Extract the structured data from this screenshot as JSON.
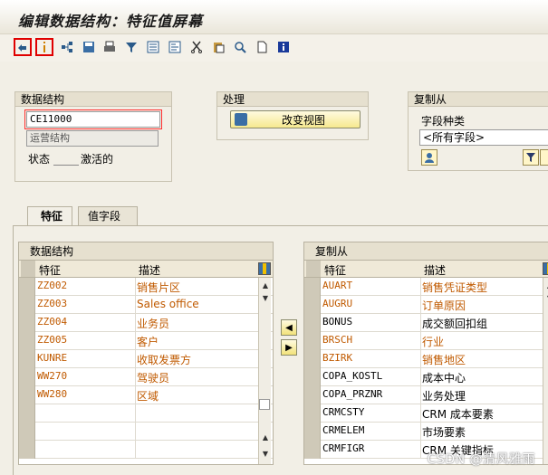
{
  "title": "编辑数据结构：特征值屏幕",
  "toolbar": {
    "icons": [
      "back-arrow-icon",
      "info-marker-icon",
      "hierarchy-icon",
      "save-icon",
      "print-icon",
      "filter-icon",
      "list-icon",
      "detail-icon",
      "cut-icon",
      "paste-icon",
      "find-icon",
      "new-page-icon",
      "info-icon"
    ]
  },
  "data_structure": {
    "group_title": "数据结构",
    "code": "CE11000",
    "description": "运营结构",
    "status_label": "状态",
    "status_value": "激活的"
  },
  "processing": {
    "group_title": "处理",
    "change_view_label": "改变视图"
  },
  "copy_from": {
    "group_title": "复制从",
    "field_type_label": "字段种类",
    "field_type_value": "<所有字段>"
  },
  "tabs": [
    {
      "label": "特征",
      "active": true
    },
    {
      "label": "值字段",
      "active": false
    }
  ],
  "left_table": {
    "title": "数据结构",
    "col1": "特征",
    "col2": "描述",
    "rows": [
      {
        "c1": "ZZ002",
        "c2": "销售片区"
      },
      {
        "c1": "ZZ003",
        "c2": "Sales office"
      },
      {
        "c1": "ZZ004",
        "c2": "业务员"
      },
      {
        "c1": "ZZ005",
        "c2": "客户"
      },
      {
        "c1": "KUNRE",
        "c2": "收取发票方"
      },
      {
        "c1": "WW270",
        "c2": "驾驶员"
      },
      {
        "c1": "WW280",
        "c2": "区域"
      },
      {
        "c1": "",
        "c2": ""
      },
      {
        "c1": "",
        "c2": ""
      },
      {
        "c1": "",
        "c2": ""
      }
    ]
  },
  "right_table": {
    "title": "复制从",
    "col1": "特征",
    "col2": "描述",
    "rows": [
      {
        "c1": "AUART",
        "c2": "销售凭证类型",
        "orange": true
      },
      {
        "c1": "AUGRU",
        "c2": "订单原因",
        "orange": true
      },
      {
        "c1": "BONUS",
        "c2": "成交额回扣组",
        "orange": false
      },
      {
        "c1": "BRSCH",
        "c2": "行业",
        "orange": true
      },
      {
        "c1": "BZIRK",
        "c2": "销售地区",
        "orange": true
      },
      {
        "c1": "COPA_KOSTL",
        "c2": "成本中心",
        "orange": false
      },
      {
        "c1": "COPA_PRZNR",
        "c2": "业务处理",
        "orange": false
      },
      {
        "c1": "CRMCSTY",
        "c2": "CRM 成本要素",
        "orange": false
      },
      {
        "c1": "CRMELEM",
        "c2": "市场要素",
        "orange": false
      },
      {
        "c1": "CRMFIGR",
        "c2": "CRM 关键指标",
        "orange": false
      }
    ]
  },
  "colors": {
    "orange_text": "#c05a00",
    "normal_text": "#000000"
  },
  "watermark": "CSDN @清风雅雨"
}
